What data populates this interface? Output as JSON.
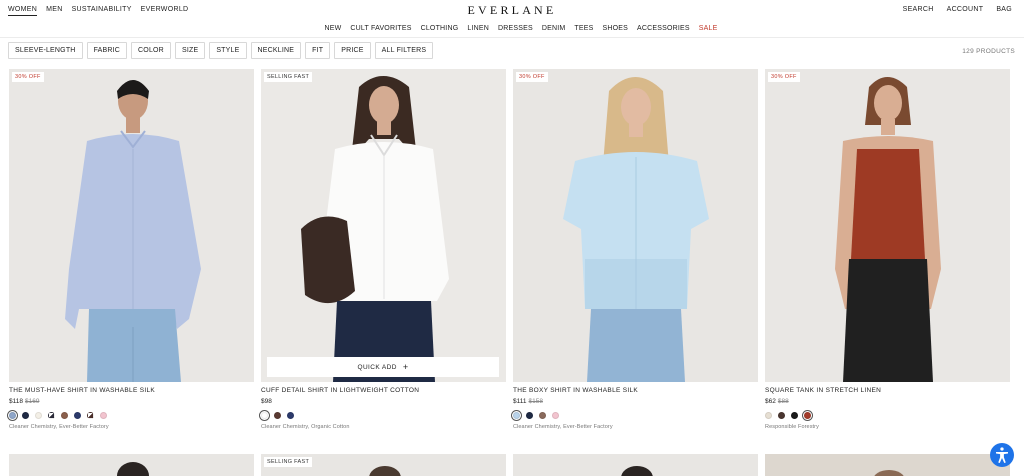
{
  "topnav": {
    "left": [
      "WOMEN",
      "MEN",
      "SUSTAINABILITY",
      "EVERWORLD"
    ],
    "logo": "EVERLANE",
    "right": [
      "SEARCH",
      "ACCOUNT",
      "BAG"
    ]
  },
  "categories": [
    "NEW",
    "CULT FAVORITES",
    "CLOTHING",
    "LINEN",
    "DRESSES",
    "DENIM",
    "TEES",
    "SHOES",
    "ACCESSORIES",
    "SALE"
  ],
  "filters": [
    "SLEEVE-LENGTH",
    "FABRIC",
    "COLOR",
    "SIZE",
    "STYLE",
    "NECKLINE",
    "FIT",
    "PRICE",
    "ALL FILTERS"
  ],
  "product_count": "129 PRODUCTS",
  "quick_add": "QUICK ADD",
  "products": [
    {
      "badge": "30% OFF",
      "name": "THE MUST-HAVE SHIRT IN WASHABLE SILK",
      "price": "$118",
      "orig_price": "$169",
      "tagline": "Cleaner Chemistry, Ever-Better Factory",
      "swatches": [
        "#8fa6c9",
        "#1f2a44",
        "#f3efe6",
        "#2b2b3a",
        "#8a5f4c",
        "#2c3a6b",
        "#4a2e2a",
        "#f2c4cf"
      ]
    },
    {
      "badge": "SELLING FAST",
      "name": "CUFF DETAIL SHIRT IN LIGHTWEIGHT COTTON",
      "price": "$98",
      "orig_price": "",
      "tagline": "Cleaner Chemistry, Organic Cotton",
      "swatches": [
        "#ffffff",
        "#5a3a32",
        "#2c3a6b"
      ]
    },
    {
      "badge": "30% OFF",
      "name": "THE BOXY SHIRT IN WASHABLE SILK",
      "price": "$111",
      "orig_price": "$158",
      "tagline": "Cleaner Chemistry, Ever-Better Factory",
      "swatches": [
        "#b9d3ea",
        "#1f2a44",
        "#8a6a5c",
        "#f2c4cf"
      ]
    },
    {
      "badge": "30% OFF",
      "name": "SQUARE TANK IN STRETCH LINEN",
      "price": "$62",
      "orig_price": "$88",
      "tagline": "Responsible Forestry",
      "swatches": [
        "#e6dfd3",
        "#4a3630",
        "#1a1a1a",
        "#a33b2a"
      ]
    }
  ],
  "row2_badge": "SELLING FAST",
  "accessibility_icon": "accessibility-icon",
  "colors": {
    "sale": "#c0392b",
    "accessibility": "#1e73e8"
  }
}
